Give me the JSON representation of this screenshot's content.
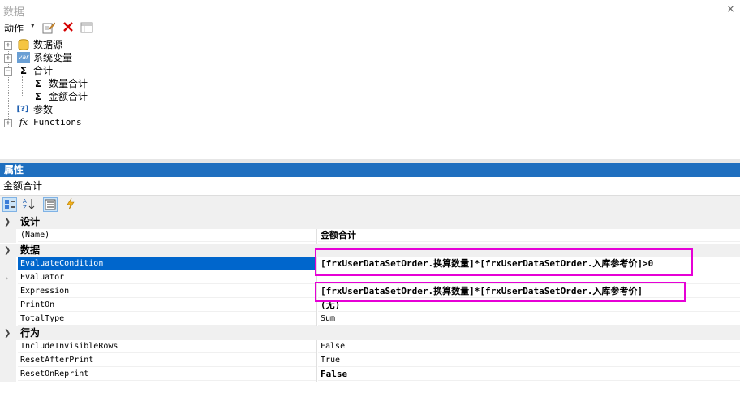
{
  "data_panel": {
    "title": "数据",
    "close_glyph": "×",
    "toolbar": {
      "actions_label": "动作",
      "dropdown_glyph": "▾"
    },
    "tree": [
      {
        "label": "数据源",
        "icon": "database-icon"
      },
      {
        "label": "系统变量",
        "icon": "var-icon",
        "icon_text": "var"
      },
      {
        "label": "合计",
        "icon": "sigma-icon",
        "icon_text": "Σ"
      },
      {
        "label": "数量合计",
        "icon": "sigma-icon",
        "icon_text": "Σ"
      },
      {
        "label": "金额合计",
        "icon": "sigma-icon",
        "icon_text": "Σ"
      },
      {
        "label": "参数",
        "icon": "parameter-icon",
        "icon_text": "[?]"
      },
      {
        "label": "Functions",
        "icon": "function-icon",
        "icon_text": "fx"
      }
    ]
  },
  "properties_panel": {
    "title": "属性",
    "selected_object": "金额合计",
    "categories": [
      {
        "label": "设计",
        "rows": [
          {
            "name": "(Name)",
            "value": "金额合计"
          }
        ]
      },
      {
        "label": "数据",
        "rows": [
          {
            "name": "EvaluateCondition",
            "value": "[frxUserDataSetOrder.换算数量]*[frxUserDataSetOrder.入库参考价]>0"
          },
          {
            "name": "Evaluator",
            "value": ""
          },
          {
            "name": "Expression",
            "value": "[frxUserDataSetOrder.换算数量]*[frxUserDataSetOrder.入库参考价]"
          },
          {
            "name": "PrintOn",
            "value": "(无)"
          },
          {
            "name": "TotalType",
            "value": "Sum"
          }
        ]
      },
      {
        "label": "行为",
        "rows": [
          {
            "name": "IncludeInvisibleRows",
            "value": "False"
          },
          {
            "name": "ResetAfterPrint",
            "value": "True"
          },
          {
            "name": "ResetOnReprint",
            "value": "False"
          }
        ]
      }
    ]
  },
  "colors": {
    "header_blue": "#1f6fbf",
    "selection_blue": "#0066cc",
    "highlight_magenta": "#e600d6"
  }
}
